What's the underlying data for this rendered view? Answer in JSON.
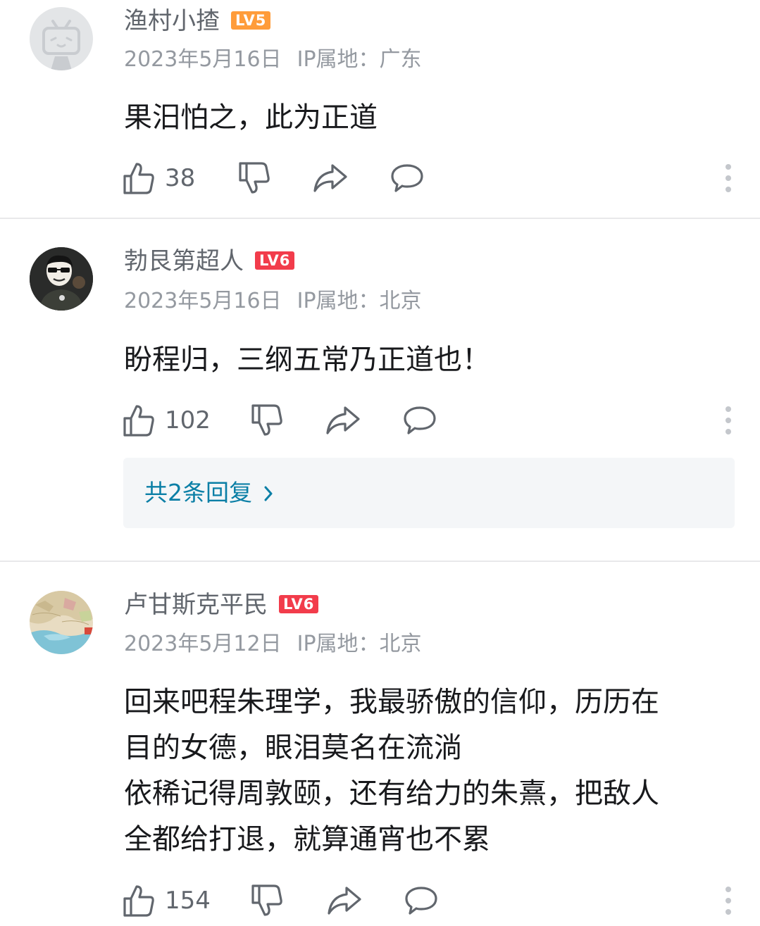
{
  "colors": {
    "lv5": "#ff9c3a",
    "lv6": "#f23c4b",
    "link": "#0b7fa6",
    "meta": "#9499a0",
    "icon": "#61666d"
  },
  "icons": [
    "thumbs-up-icon",
    "thumbs-down-icon",
    "share-icon",
    "reply-icon",
    "more-vertical-icon",
    "chevron-right-icon"
  ],
  "comments": [
    {
      "username": "渔村小揸",
      "level": "LV5",
      "date": "2023年5月16日",
      "ip": "IP属地：广东",
      "content": [
        "果汨怕之，此为正道"
      ],
      "likes": "38"
    },
    {
      "username": "勃艮第超人",
      "level": "LV6",
      "date": "2023年5月16日",
      "ip": "IP属地：北京",
      "content": [
        "盼程归，三纲五常乃正道也！"
      ],
      "likes": "102",
      "replies_link": "共2条回复"
    },
    {
      "username": "卢甘斯克平民",
      "level": "LV6",
      "date": "2023年5月12日",
      "ip": "IP属地：北京",
      "content": [
        "回来吧程朱理学，我最骄傲的信仰，历历在",
        "目的女德，眼泪莫名在流淌",
        "依稀记得周敦颐，还有给力的朱熹，把敌人",
        "全都给打退，就算通宵也不累"
      ],
      "likes": "154"
    }
  ]
}
